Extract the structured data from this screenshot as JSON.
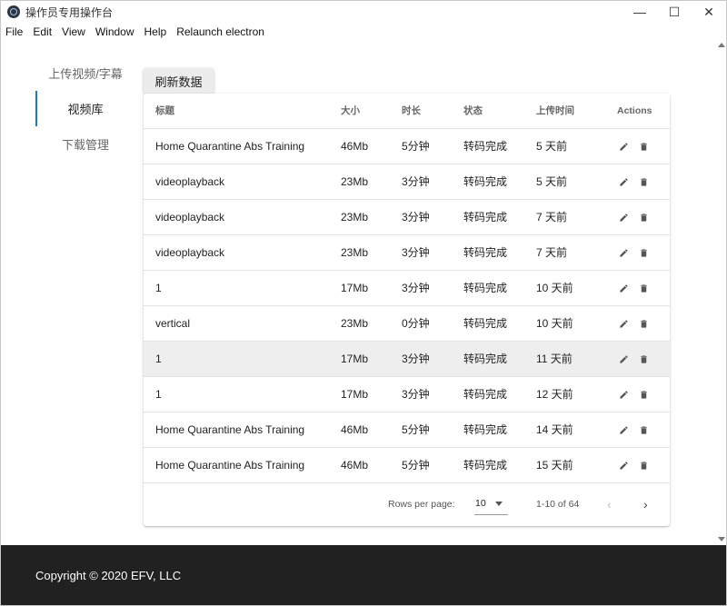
{
  "window": {
    "title": "操作员专用操作台",
    "controls": {
      "minimize": "—",
      "maximize": "☐",
      "close": "✕"
    }
  },
  "menubar": [
    "File",
    "Edit",
    "View",
    "Window",
    "Help",
    "Relaunch electron"
  ],
  "sidebar": {
    "items": [
      {
        "label": "上传视频/字幕",
        "active": false
      },
      {
        "label": "视频库",
        "active": true
      },
      {
        "label": "下载管理",
        "active": false
      }
    ],
    "accent": "#1976d2"
  },
  "toolbar": {
    "refresh_label": "刷新数据"
  },
  "table": {
    "headers": {
      "title": "标题",
      "size": "大小",
      "duration": "时长",
      "status": "状态",
      "uploaded": "上传时间",
      "actions": "Actions"
    },
    "rows": [
      {
        "title": "Home Quarantine Abs Training",
        "size": "46Mb",
        "duration": "5分钟",
        "status": "转码完成",
        "uploaded": "5 天前"
      },
      {
        "title": "videoplayback",
        "size": "23Mb",
        "duration": "3分钟",
        "status": "转码完成",
        "uploaded": "5 天前"
      },
      {
        "title": "videoplayback",
        "size": "23Mb",
        "duration": "3分钟",
        "status": "转码完成",
        "uploaded": "7 天前"
      },
      {
        "title": "videoplayback",
        "size": "23Mb",
        "duration": "3分钟",
        "status": "转码完成",
        "uploaded": "7 天前"
      },
      {
        "title": "1",
        "size": "17Mb",
        "duration": "3分钟",
        "status": "转码完成",
        "uploaded": "10 天前"
      },
      {
        "title": "vertical",
        "size": "23Mb",
        "duration": "0分钟",
        "status": "转码完成",
        "uploaded": "10 天前"
      },
      {
        "title": "1",
        "size": "17Mb",
        "duration": "3分钟",
        "status": "转码完成",
        "uploaded": "11 天前"
      },
      {
        "title": "1",
        "size": "17Mb",
        "duration": "3分钟",
        "status": "转码完成",
        "uploaded": "12 天前"
      },
      {
        "title": "Home Quarantine Abs Training",
        "size": "46Mb",
        "duration": "5分钟",
        "status": "转码完成",
        "uploaded": "14 天前"
      },
      {
        "title": "Home Quarantine Abs Training",
        "size": "46Mb",
        "duration": "5分钟",
        "status": "转码完成",
        "uploaded": "15 天前"
      }
    ],
    "highlighted_row_index": 6,
    "row_icons": [
      "pencil-icon",
      "trash-icon"
    ]
  },
  "pagination": {
    "rows_per_page_label": "Rows per page:",
    "rows_per_page": "10",
    "range": "1-10 of 64",
    "prev": "‹",
    "next": "›"
  },
  "footer": {
    "copyright": "Copyright © 2020 EFV, LLC",
    "background": "#212121"
  }
}
